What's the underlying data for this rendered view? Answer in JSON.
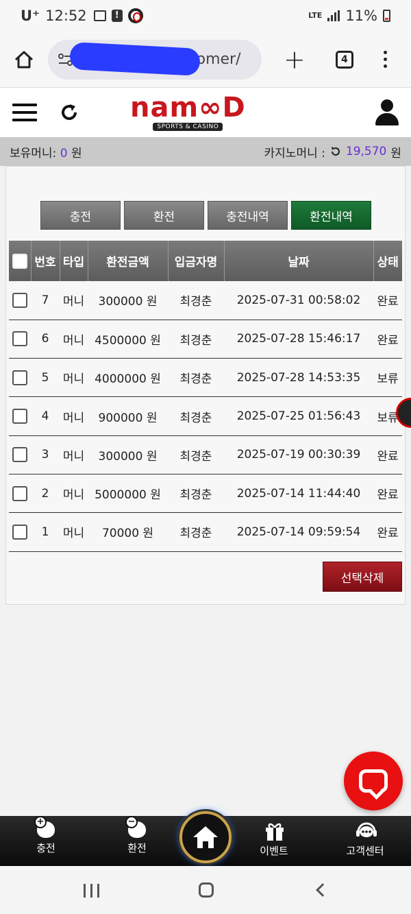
{
  "status_bar": {
    "carrier": "U⁺",
    "time": "12:52",
    "network": "LTE",
    "battery": "11%"
  },
  "browser": {
    "url_suffix": "tomer/",
    "tab_count": "4"
  },
  "header": {
    "logo_text": "nam∞D",
    "logo_sub": "SPORTS & CASINO"
  },
  "money": {
    "holding_label": "보유머니:",
    "holding_value": "0",
    "holding_unit": "원",
    "casino_label": "카지노머니 :",
    "casino_value": "19,570",
    "casino_unit": "원"
  },
  "tabs": [
    {
      "label": "충전"
    },
    {
      "label": "환전"
    },
    {
      "label": "충전내역"
    },
    {
      "label": "환전내역"
    }
  ],
  "table": {
    "headers": [
      "번호",
      "타입",
      "환전금액",
      "입금자명",
      "날짜",
      "상태"
    ],
    "rows": [
      {
        "no": "7",
        "type": "머니",
        "amount": "300000 원",
        "name": "최경춘",
        "date": "2025-07-31 00:58:02",
        "status": "완료"
      },
      {
        "no": "6",
        "type": "머니",
        "amount": "4500000 원",
        "name": "최경춘",
        "date": "2025-07-28 15:46:17",
        "status": "완료"
      },
      {
        "no": "5",
        "type": "머니",
        "amount": "4000000 원",
        "name": "최경춘",
        "date": "2025-07-28 14:53:35",
        "status": "보류"
      },
      {
        "no": "4",
        "type": "머니",
        "amount": "900000 원",
        "name": "최경춘",
        "date": "2025-07-25 01:56:43",
        "status": "보류"
      },
      {
        "no": "3",
        "type": "머니",
        "amount": "300000 원",
        "name": "최경춘",
        "date": "2025-07-19 00:30:39",
        "status": "완료"
      },
      {
        "no": "2",
        "type": "머니",
        "amount": "5000000 원",
        "name": "최경춘",
        "date": "2025-07-14 11:44:40",
        "status": "완료"
      },
      {
        "no": "1",
        "type": "머니",
        "amount": "70000 원",
        "name": "최경춘",
        "date": "2025-07-14 09:59:54",
        "status": "완료"
      }
    ]
  },
  "actions": {
    "delete_selected": "선택삭제"
  },
  "bottom_nav": [
    {
      "label": "충전",
      "icon": "piggy-plus-icon"
    },
    {
      "label": "환전",
      "icon": "piggy-minus-icon"
    },
    {
      "label": "이벤트",
      "icon": "gift-icon"
    },
    {
      "label": "고객센터",
      "icon": "support-icon"
    }
  ],
  "colors": {
    "accent_purple": "#6a2fd1",
    "active_tab": "#0e5a26",
    "delete_red": "#7d0e14",
    "chat_red": "#e81010",
    "logo_red": "#c8171e"
  }
}
